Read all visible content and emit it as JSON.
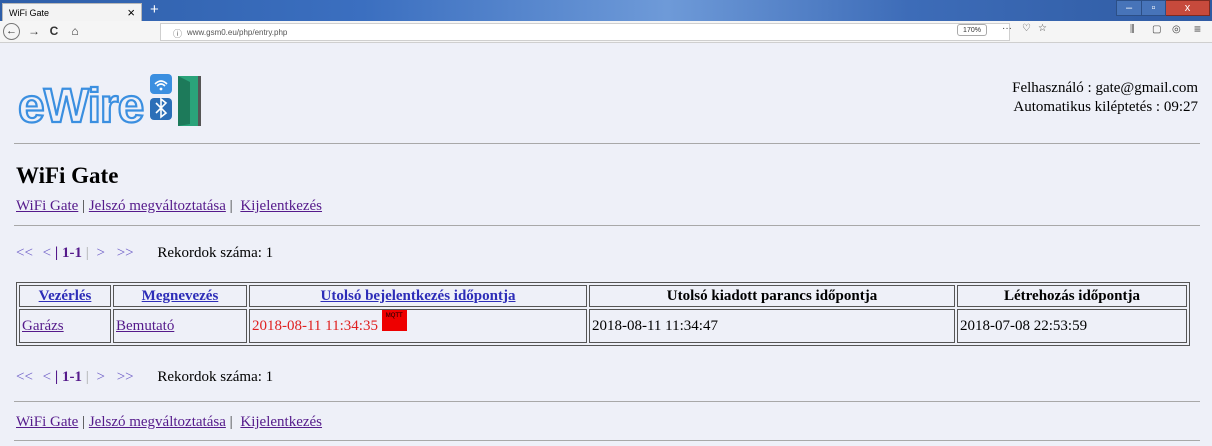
{
  "browser": {
    "tab_title": "WiFi Gate",
    "tab_close": "×",
    "new_tab": "+",
    "url": "www.gsm0.eu/php/entry.php",
    "zoom": "170%",
    "window_controls": {
      "minimize": "–",
      "maximize": "▫",
      "close": "x"
    },
    "nav": {
      "back": "←",
      "forward": "→",
      "reload": "C",
      "home": "⌂"
    },
    "url_icons": {
      "info": "ⓘ",
      "more": "···",
      "pocket": "♡",
      "bookmark": "☆"
    },
    "toolbar_icons": {
      "library": "⫼",
      "sidebar": "▢",
      "account": "◎",
      "menu": "≡"
    }
  },
  "header": {
    "logo_text": "eWire",
    "user_line": "Felhasználó : gate@gmail.com",
    "logout_line": "Automatikus kiléptetés : 09:27"
  },
  "page": {
    "title": "WiFi Gate"
  },
  "nav_links": {
    "wifi_gate": "WiFi Gate",
    "sep1": "|",
    "change_password": "Jelszó megváltoztatása",
    "sep2": "|",
    "logout": "Kijelentkezés"
  },
  "pager": {
    "first": "<<",
    "prev": "<",
    "bar": "|",
    "current": "1-1",
    "bar2": "|",
    "next": ">",
    "last": ">>",
    "record_count": "Rekordok száma: 1"
  },
  "table": {
    "headers": {
      "control": "Vezérlés",
      "name": "Megnevezés",
      "last_login": "Utolsó bejelentkezés időpontja",
      "last_command": "Utolsó kiadott parancs időpontja",
      "created": "Létrehozás időpontja"
    },
    "rows": [
      {
        "control": "Garázs",
        "name": "Bemutató",
        "last_login": "2018-08-11 11:34:35",
        "badge": "MQTT",
        "last_command": "2018-08-11 11:34:47",
        "created": "2018-07-08 22:53:59"
      }
    ]
  },
  "colors": {
    "background": "#eef0f8",
    "link": "#551a8b",
    "header_link": "#2d2db8",
    "highlight_date": "#e02020",
    "badge": "#ee0000",
    "logo_blue": "#3b8fe0",
    "logo_green": "#2aa37a"
  }
}
